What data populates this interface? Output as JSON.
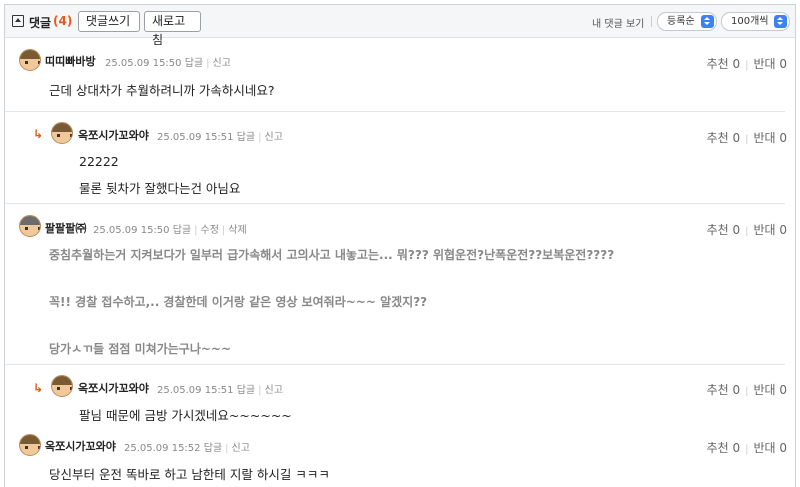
{
  "header": {
    "title": "댓글",
    "count": "(4)",
    "write_label": "댓글쓰기",
    "refresh_label": "새로고침",
    "my_comments_label": "내 댓글 보기",
    "order_label": "등록순",
    "page_size_label": "100개씩"
  },
  "comments": [
    {
      "nick": "띠띠빠바방",
      "date": "25.05.09 15:50",
      "actions": [
        "답글",
        "신고"
      ],
      "up": "추천 0",
      "down": "반대 0",
      "lines": [
        "근데 상대차가 추월하려니까 가속하시네요?"
      ]
    },
    {
      "nick": "옥쪼시가꼬와야",
      "date": "25.05.09 15:51",
      "actions": [
        "답글",
        "신고"
      ],
      "up": "추천 0",
      "down": "반대 0",
      "lines": [
        "22222",
        "물론 뒷차가 잘했다는건 아님요"
      ]
    },
    {
      "nick": "팔팔팔㈜",
      "date": "25.05.09 15:50",
      "actions": [
        "답글",
        "수정",
        "삭제"
      ],
      "up": "추천 0",
      "down": "반대 0",
      "lines": [
        "중침추월하는거 지켜보다가 일부러 급가속해서 고의사고 내놓고는... 뭐??? 위협운전?난폭운전??보복운전????",
        "꼭!! 경찰 접수하고,.. 경찰한데 이거랑 같은 영상 보여줘라~~~ 알겠지??",
        "당가ㅅㄲ들 점점 미쳐가는구나~~~"
      ]
    },
    {
      "nick": "옥쪼시가꼬와야",
      "date": "25.05.09 15:51",
      "actions": [
        "답글",
        "신고"
      ],
      "up": "추천 0",
      "down": "반대 0",
      "lines": [
        "팔님 때문에 금방 가시겠네요~~~~~~"
      ]
    },
    {
      "nick": "옥쪼시가꼬와야",
      "date": "25.05.09 15:52",
      "actions": [
        "답글",
        "신고"
      ],
      "up": "추천 0",
      "down": "반대 0",
      "lines": [
        "당신부터 운전 똑바로 하고 남한테 지랄 하시길 ㅋㅋㅋ"
      ]
    }
  ],
  "reply_arrow": "↳",
  "colors": {
    "accent": "#e85a1c",
    "select_blue": "#3b82f6"
  }
}
